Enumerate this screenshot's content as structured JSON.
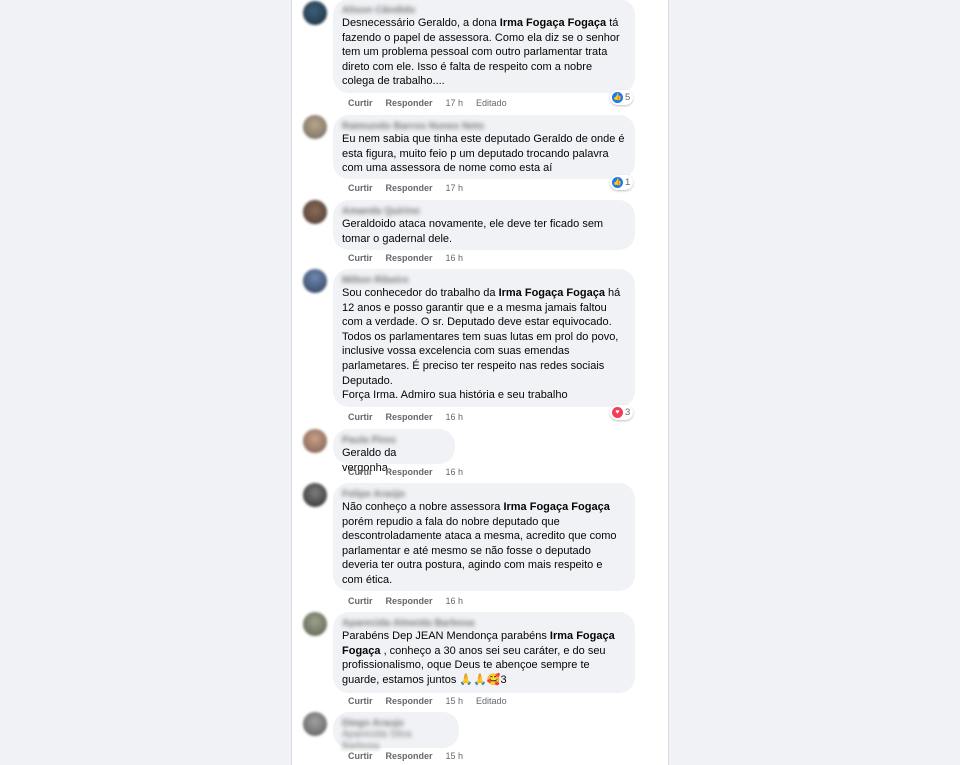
{
  "comments": [
    {
      "author": "Alison Cândido",
      "body_parts": [
        {
          "t": "Desnecessário Geraldo, a dona "
        },
        {
          "t": "Irma Fogaça Fogaça",
          "b": true
        },
        {
          "t": " tá fazendo o papel de assessora. Como ela diz se o senhor tem um problema pessoal com outro parlamentar trata direto com ele. Isso é falta de respeito com a nobre colega de trabalho...."
        }
      ],
      "actions": {
        "like": "Curtir",
        "reply": "Responder",
        "time": "17 h",
        "edited": "Editado"
      },
      "reaction": {
        "icon": "like-icon",
        "count": "5"
      }
    },
    {
      "author": "Raimundo Barros Nunes Neto",
      "body_parts": [
        {
          "t": "Eu nem sabia que tinha este deputado Geraldo de onde é esta figura, muito feio p um deputado trocando palavra com uma assessora de nome como esta aí"
        }
      ],
      "actions": {
        "like": "Curtir",
        "reply": "Responder",
        "time": "17 h"
      },
      "reaction": {
        "icon": "like-icon",
        "count": "1"
      }
    },
    {
      "author": "Amanda Quirino",
      "body_parts": [
        {
          "t": "Geraldoido ataca novamente, ele deve ter ficado sem tomar o gadernal dele."
        }
      ],
      "actions": {
        "like": "Curtir",
        "reply": "Responder",
        "time": "16 h"
      }
    },
    {
      "author": "Milton Ribeiro",
      "body_parts": [
        {
          "t": "Sou conhecedor do trabalho da "
        },
        {
          "t": "Irma Fogaça Fogaça",
          "b": true
        },
        {
          "t": " há 12 anos e posso garantir que e a mesma jamais faltou com a verdade. O sr. Deputado deve estar equivocado.\nTodos os parlamentares tem suas lutas em prol do povo, inclusive vossa excelencia com suas emendas parlametares. É preciso ter respeito nas redes sociais Deputado.\nForça Irma. Admiro sua história e seu trabalho"
        }
      ],
      "actions": {
        "like": "Curtir",
        "reply": "Responder",
        "time": "16 h"
      },
      "reaction": {
        "icon": "love-icon",
        "count": "3"
      }
    },
    {
      "author": "Paula Pires",
      "body_parts": [
        {
          "t": "Geraldo da vergonha"
        }
      ],
      "actions": {
        "like": "Curtir",
        "reply": "Responder",
        "time": "16 h"
      }
    },
    {
      "author": "Felipe Araújo",
      "body_parts": [
        {
          "t": "Não conheço a nobre assessora "
        },
        {
          "t": "Irma Fogaça Fogaça",
          "b": true
        },
        {
          "t": " porém repudio a fala do nobre deputado que descontroladamente ataca a mesma, acredito que como parlamentar e até mesmo se não fosse o deputado deveria ter outra postura, agindo com mais respeito e com ética."
        }
      ],
      "actions": {
        "like": "Curtir",
        "reply": "Responder",
        "time": "16 h"
      }
    },
    {
      "author": "Aparecida Almeida Barbosa",
      "body_parts": [
        {
          "t": "Parabéns Dep JEAN Mendonça parabéns "
        },
        {
          "t": "Irma Fogaça Fogaça",
          "b": true
        },
        {
          "t": " , conheço a 30 anos sei seu caráter, e do seu profissionalismo, oque Deus te abençoe sempre te guarde, estamos juntos 🙏🙏🥰3"
        }
      ],
      "actions": {
        "like": "Curtir",
        "reply": "Responder",
        "time": "15 h",
        "edited": "Editado"
      }
    },
    {
      "author": "Diego Araujo",
      "author_line2": "Aparecida Silva Barbosa",
      "body_parts": [],
      "actions": {
        "like": "Curtir",
        "reply": "Responder",
        "time": "15 h"
      }
    }
  ],
  "colors": {
    "bubble": "#f0f2f5",
    "meta_text": "#65676b",
    "like_blue": "#1877f2",
    "love_red": "#f33e58"
  }
}
